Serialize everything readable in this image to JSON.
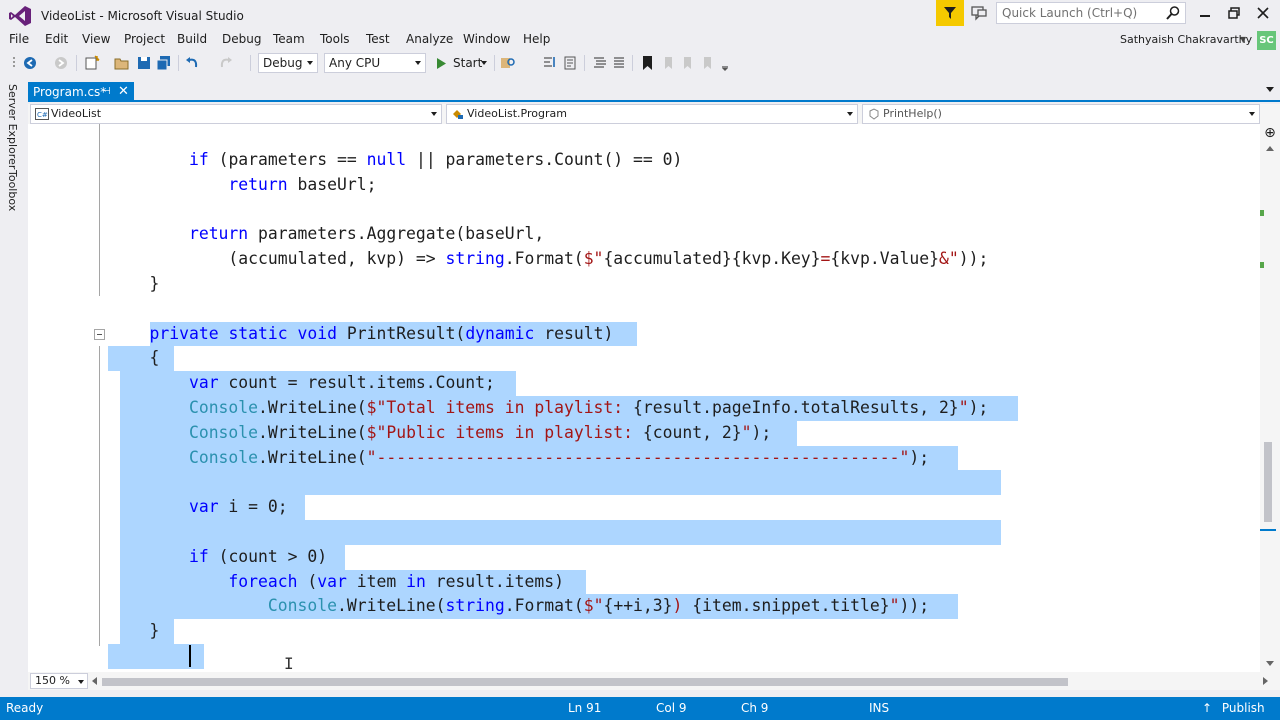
{
  "window": {
    "title": "VideoList - Microsoft Visual Studio",
    "quick_launch_placeholder": "Quick Launch (Ctrl+Q)",
    "user_name": "Sathyaish Chakravarthy",
    "avatar_initials": "SC",
    "accent_color": "#007acc",
    "notification_color": "#f5c900"
  },
  "menu": {
    "items": [
      "File",
      "Edit",
      "View",
      "Project",
      "Build",
      "Debug",
      "Team",
      "Tools",
      "Test",
      "Analyze",
      "Window",
      "Help"
    ]
  },
  "toolbar": {
    "configuration": "Debug",
    "platform": "Any CPU",
    "start_label": "Start"
  },
  "side_panel": {
    "tabs": [
      "Server Explorer",
      "Toolbox"
    ]
  },
  "document_tab": {
    "label": "Program.cs*",
    "pin_glyph": "⊣",
    "close_glyph": "✕"
  },
  "navigation": {
    "project": "VideoList",
    "class": "VideoList.Program",
    "member": "PrintHelp()"
  },
  "editor": {
    "zoom": "150 %",
    "selection_color": "#add6ff",
    "lines": [
      {
        "tokens": [
          {
            "t": "        "
          },
          {
            "t": "if",
            "c": "kw"
          },
          {
            "t": " (parameters == "
          },
          {
            "t": "null",
            "c": "kw"
          },
          {
            "t": " || parameters.Count() == 0)"
          }
        ]
      },
      {
        "tokens": [
          {
            "t": "            "
          },
          {
            "t": "return",
            "c": "kw"
          },
          {
            "t": " baseUrl;"
          }
        ]
      },
      {
        "tokens": []
      },
      {
        "tokens": [
          {
            "t": "        "
          },
          {
            "t": "return",
            "c": "kw"
          },
          {
            "t": " parameters.Aggregate(baseUrl,"
          }
        ]
      },
      {
        "tokens": [
          {
            "t": "            (accumulated, kvp) => "
          },
          {
            "t": "string",
            "c": "kw"
          },
          {
            "t": ".Format("
          },
          {
            "t": "$\"",
            "c": "st"
          },
          {
            "t": "{accumulated}"
          },
          {
            "t": "{kvp.Key}",
            "c": ""
          },
          {
            "t": "=",
            "c": "st"
          },
          {
            "t": "{kvp.Value}"
          },
          {
            "t": "&\"",
            "c": "st"
          },
          {
            "t": "));"
          }
        ]
      },
      {
        "tokens": [
          {
            "t": "    }"
          }
        ]
      },
      {
        "tokens": []
      },
      {
        "tokens": [
          {
            "t": "    "
          },
          {
            "t": "private",
            "c": "kw"
          },
          {
            "t": " "
          },
          {
            "t": "static",
            "c": "kw"
          },
          {
            "t": " "
          },
          {
            "t": "void",
            "c": "kw"
          },
          {
            "t": " PrintResult("
          },
          {
            "t": "dynamic",
            "c": "kw"
          },
          {
            "t": " result)"
          }
        ]
      },
      {
        "tokens": [
          {
            "t": "    {"
          }
        ]
      },
      {
        "tokens": [
          {
            "t": "        "
          },
          {
            "t": "var",
            "c": "kw"
          },
          {
            "t": " count = result.items.Count;"
          }
        ]
      },
      {
        "tokens": [
          {
            "t": "        "
          },
          {
            "t": "Console",
            "c": "ty"
          },
          {
            "t": ".WriteLine("
          },
          {
            "t": "$\"Total items in playlist: ",
            "c": "st"
          },
          {
            "t": "{result.pageInfo.totalResults, 2}"
          },
          {
            "t": "\"",
            "c": "st"
          },
          {
            "t": ");"
          }
        ]
      },
      {
        "tokens": [
          {
            "t": "        "
          },
          {
            "t": "Console",
            "c": "ty"
          },
          {
            "t": ".WriteLine("
          },
          {
            "t": "$\"Public items in playlist: ",
            "c": "st"
          },
          {
            "t": "{count, 2}"
          },
          {
            "t": "\"",
            "c": "st"
          },
          {
            "t": ");"
          }
        ]
      },
      {
        "tokens": [
          {
            "t": "        "
          },
          {
            "t": "Console",
            "c": "ty"
          },
          {
            "t": ".WriteLine("
          },
          {
            "t": "\"-----------------------------------------------------\"",
            "c": "st"
          },
          {
            "t": ");"
          }
        ]
      },
      {
        "tokens": []
      },
      {
        "tokens": [
          {
            "t": "        "
          },
          {
            "t": "var",
            "c": "kw"
          },
          {
            "t": " i = 0;"
          }
        ]
      },
      {
        "tokens": []
      },
      {
        "tokens": [
          {
            "t": "        "
          },
          {
            "t": "if",
            "c": "kw"
          },
          {
            "t": " (count > 0)"
          }
        ]
      },
      {
        "tokens": [
          {
            "t": "            "
          },
          {
            "t": "foreach",
            "c": "kw"
          },
          {
            "t": " ("
          },
          {
            "t": "var",
            "c": "kw"
          },
          {
            "t": " item "
          },
          {
            "t": "in",
            "c": "kw"
          },
          {
            "t": " result.items)"
          }
        ]
      },
      {
        "tokens": [
          {
            "t": "                "
          },
          {
            "t": "Console",
            "c": "ty"
          },
          {
            "t": ".WriteLine("
          },
          {
            "t": "string",
            "c": "kw"
          },
          {
            "t": ".Format("
          },
          {
            "t": "$\"",
            "c": "st"
          },
          {
            "t": "{++i,3}"
          },
          {
            "t": ") ",
            "c": "st"
          },
          {
            "t": "{item.snippet.title}"
          },
          {
            "t": "\"",
            "c": "st"
          },
          {
            "t": "));"
          }
        ]
      },
      {
        "tokens": [
          {
            "t": "    }"
          }
        ]
      },
      {
        "tokens": []
      }
    ]
  },
  "status": {
    "state": "Ready",
    "line": "Ln 91",
    "col": "Col 9",
    "ch": "Ch 9",
    "mode": "INS",
    "publish_label": "Publish"
  }
}
